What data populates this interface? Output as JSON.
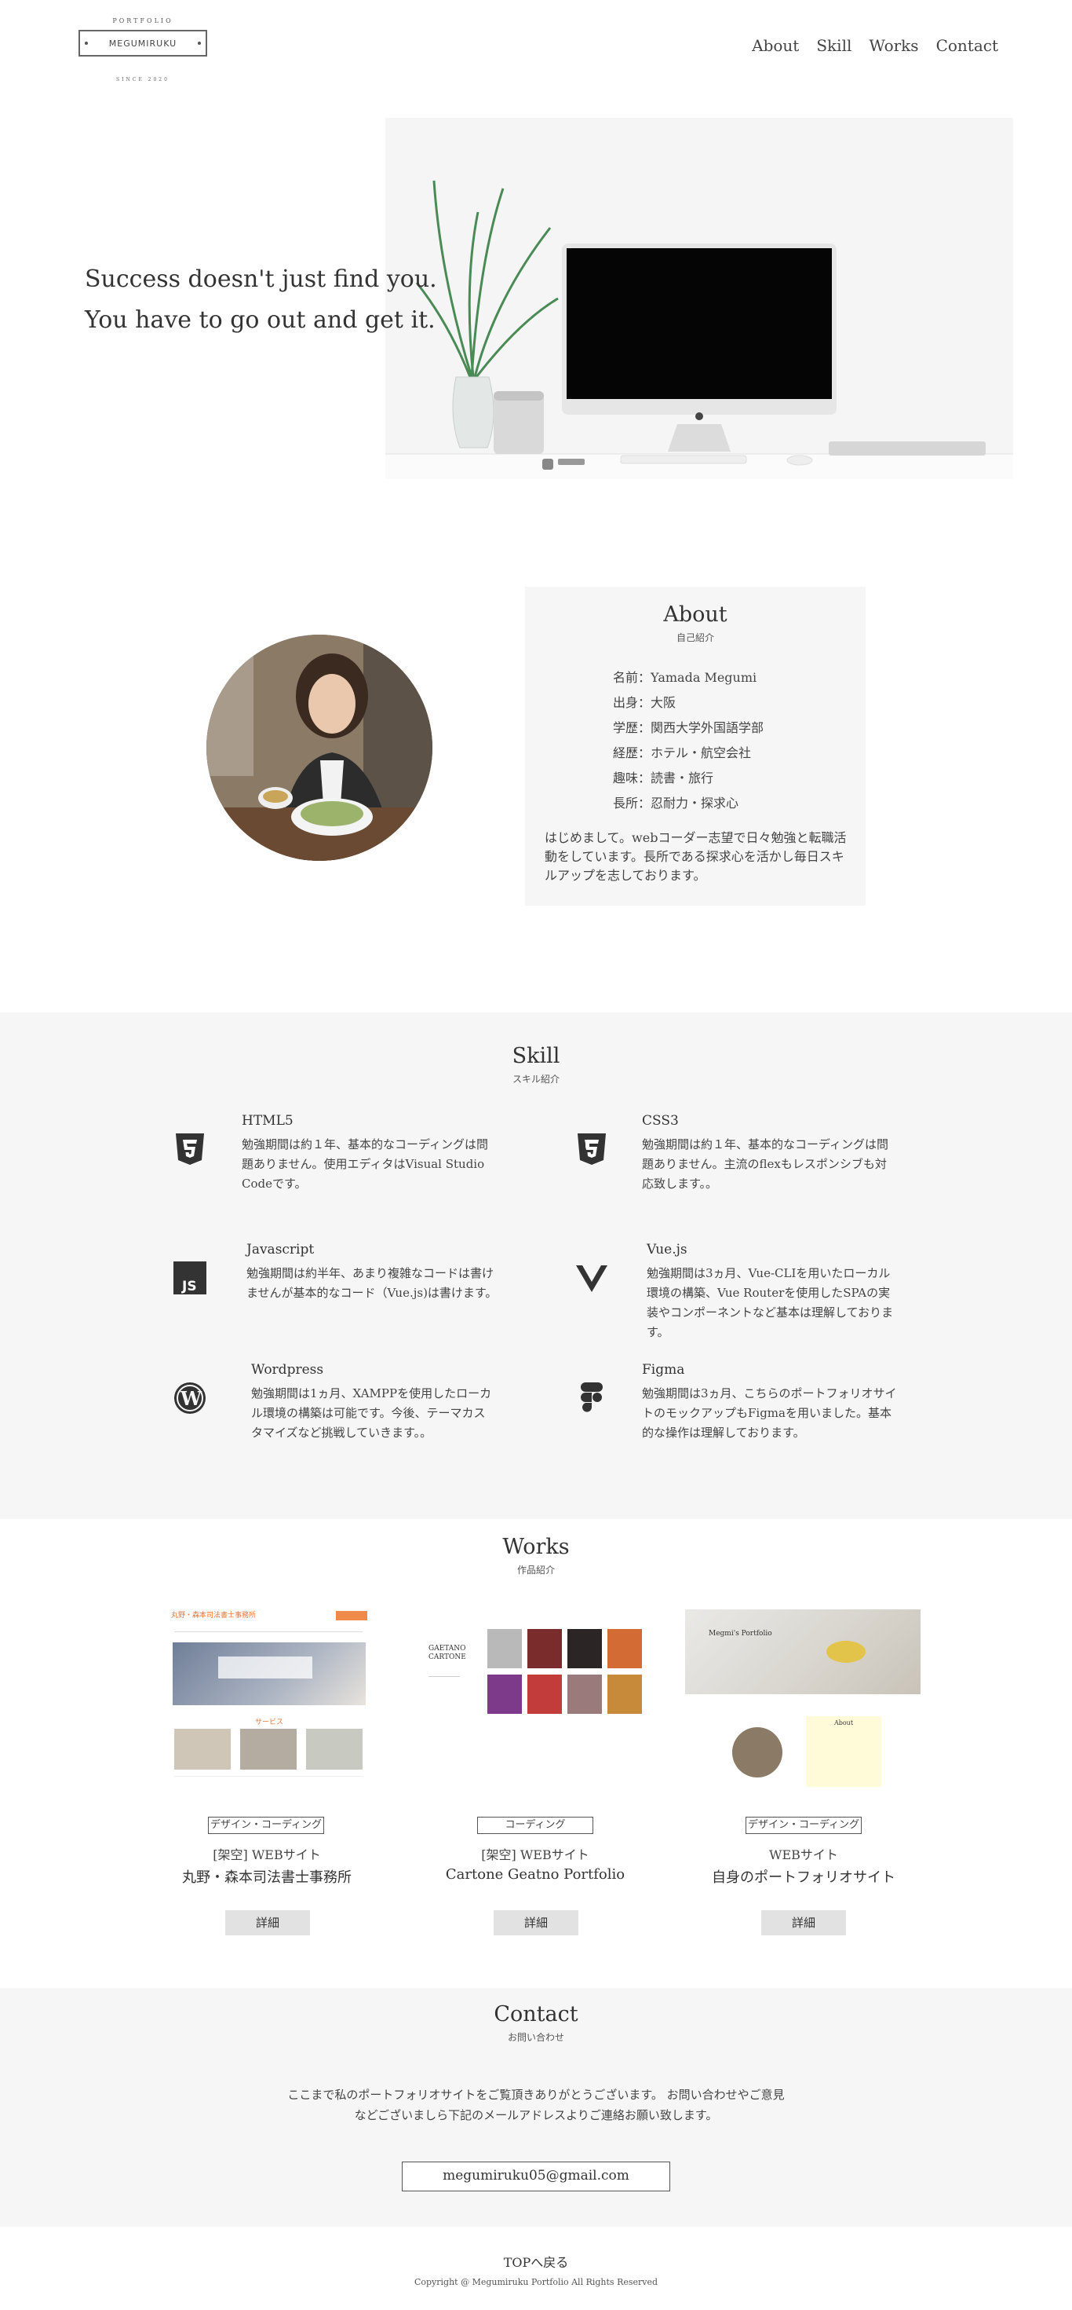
{
  "header": {
    "logo_top": "PORTFOLIO",
    "logo_name": "MEGUMIRUKU",
    "logo_bottom": "SINCE 2020",
    "nav": [
      "About",
      "Skill",
      "Works",
      "Contact"
    ]
  },
  "hero": {
    "line1": "Success doesn't just find you.",
    "line2": "You have to go out and get it."
  },
  "about": {
    "title": "About",
    "subtitle": "自己紹介",
    "items": [
      "名前：Yamada Megumi",
      "出身：大阪",
      "学歴：関西大学外国語学部",
      "経歴：ホテル・航空会社",
      "趣味：読書・旅行",
      "長所：忍耐力・探求心"
    ],
    "intro": "はじめまして。webコーダー志望で日々勉強と転職活動をしています。長所である探求心を活かし毎日スキルアップを志しております。"
  },
  "skill": {
    "title": "Skill",
    "subtitle": "スキル紹介",
    "items": [
      {
        "name": "HTML5",
        "desc": "勉強期間は約１年、基本的なコーディングは問題ありません。使用エディタはVisual Studio Codeです。",
        "icon": "html5-icon"
      },
      {
        "name": "CSS3",
        "desc": "勉強期間は約１年、基本的なコーディングは問題ありません。主流のflexもレスポンシブも対応致します。。",
        "icon": "css3-icon"
      },
      {
        "name": "Javascript",
        "desc": "勉強期間は約半年、あまり複雑なコードは書けませんが基本的なコード（Vue.js)は書けます。",
        "icon": "js-icon"
      },
      {
        "name": "Vue.js",
        "desc": "勉強期間は3ヵ月、Vue-CLIを用いたローカル環境の構築、Vue Routerを使用したSPAの実装やコンポーネントなど基本は理解しております。",
        "icon": "vue-icon"
      },
      {
        "name": "Wordpress",
        "desc": "勉強期間は1ヵ月、XAMPPを使用したローカル環境の構築は可能です。今後、テーマカスタマイズなど挑戦していきます。。",
        "icon": "wordpress-icon"
      },
      {
        "name": "Figma",
        "desc": "勉強期間は3ヵ月、こちらのポートフォリオサイトのモックアップもFigmaを用いました。基本的な操作は理解しております。",
        "icon": "figma-icon"
      }
    ]
  },
  "works": {
    "title": "Works",
    "subtitle": "作品紹介",
    "items": [
      {
        "tag": "デザイン・コーディング",
        "category": "[架空] WEBサイト",
        "name": "丸野・森本司法書士事務所",
        "button": "詳細",
        "thumb_title": "丸野・森本司法書士事務所",
        "thumb_section": "サービス"
      },
      {
        "tag": "コーディング",
        "category": "[架空] WEBサイト",
        "name": "Cartone Geatno Portfolio",
        "button": "詳細",
        "thumb_title": "GAETANO CARTONE"
      },
      {
        "tag": "デザイン・コーディング",
        "category": "WEBサイト",
        "name": "自身のポートフォリオサイト",
        "button": "詳細",
        "thumb_title": "Megmi's Portfolio",
        "thumb_section": "About"
      }
    ]
  },
  "contact": {
    "title": "Contact",
    "subtitle": "お問い合わせ",
    "line1": "ここまで私のポートフォリオサイトをご覧頂きありがとうございます。 お問い合わせやご意見",
    "line2": "などございましら下記のメールアドレスよりご連絡お願い致します。",
    "email": "megumiruku05@gmail.com"
  },
  "footer": {
    "top_link": "TOPへ戻る",
    "copyright": "Copyright @ Megumiruku Portfolio All Rights Reserved"
  }
}
